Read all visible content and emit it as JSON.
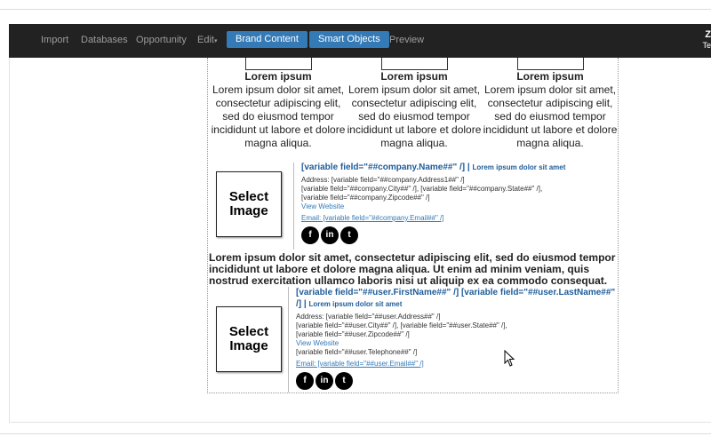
{
  "nav": {
    "import": "Import",
    "databases": "Databases",
    "opportunity": "Opportunity",
    "edit": "Edit",
    "brand_content": "Brand Content",
    "smart_objects": "Smart Objects",
    "preview": "Preview",
    "logo_top": "Z",
    "logo_bottom": "Te"
  },
  "columns": [
    {
      "title": "Lorem ipsum",
      "body": "Lorem ipsum dolor sit amet, consectetur adipiscing elit, sed do eiusmod tempor incididunt ut labore et dolore magna aliqua."
    },
    {
      "title": "Lorem ipsum",
      "body": "Lorem ipsum dolor sit amet, consectetur adipiscing elit, sed do eiusmod tempor incididunt ut labore et dolore magna aliqua."
    },
    {
      "title": "Lorem ipsum",
      "body": "Lorem ipsum dolor sit amet, consectetur adipiscing elit, sed do eiusmod tempor incididunt ut labore et dolore magna aliqua."
    }
  ],
  "company": {
    "image_label": "Select Image",
    "name": "[variable field=\"##company.Name##\" /]",
    "sep": " | ",
    "tagline": "Lorem ipsum dolor sit amet",
    "address": "Address: [variable field=\"##company.Address1##\" /]",
    "city_state": "[variable field=\"##company.City##\" /], [variable field=\"##company.State##\" /],",
    "zip": "[variable field=\"##company.Zipcode##\" /]",
    "website": "View Website",
    "email": "Email: [variable field=\"##company.Email##\" /]"
  },
  "paragraph": "Lorem ipsum dolor sit amet, consectetur adipiscing elit, sed do eiusmod tempor incididunt ut labore et dolore magna aliqua. Ut enim ad minim veniam, quis nostrud exercitation ullamco laboris nisi ut aliquip ex ea commodo consequat.",
  "user": {
    "image_label": "Select Image",
    "name": "[variable field=\"##user.FirstName##\" /] [variable field=\"##user.LastName##\" /]",
    "sep": " | ",
    "tagline": "Lorem ipsum dolor sit amet",
    "address": "Address: [variable field=\"##user.Address##\" /]",
    "city_state": "[variable field=\"##user.City##\" /], [variable field=\"##user.State##\" /],",
    "zip": "[variable field=\"##user.Zipcode##\" /]",
    "website": "View Website",
    "telephone": "[variable field=\"##user.Telephone##\" /]",
    "email": "Email: [variable field=\"##user.Email##\" /]"
  },
  "social": {
    "facebook": "f",
    "linkedin": "in",
    "twitter": "t"
  }
}
